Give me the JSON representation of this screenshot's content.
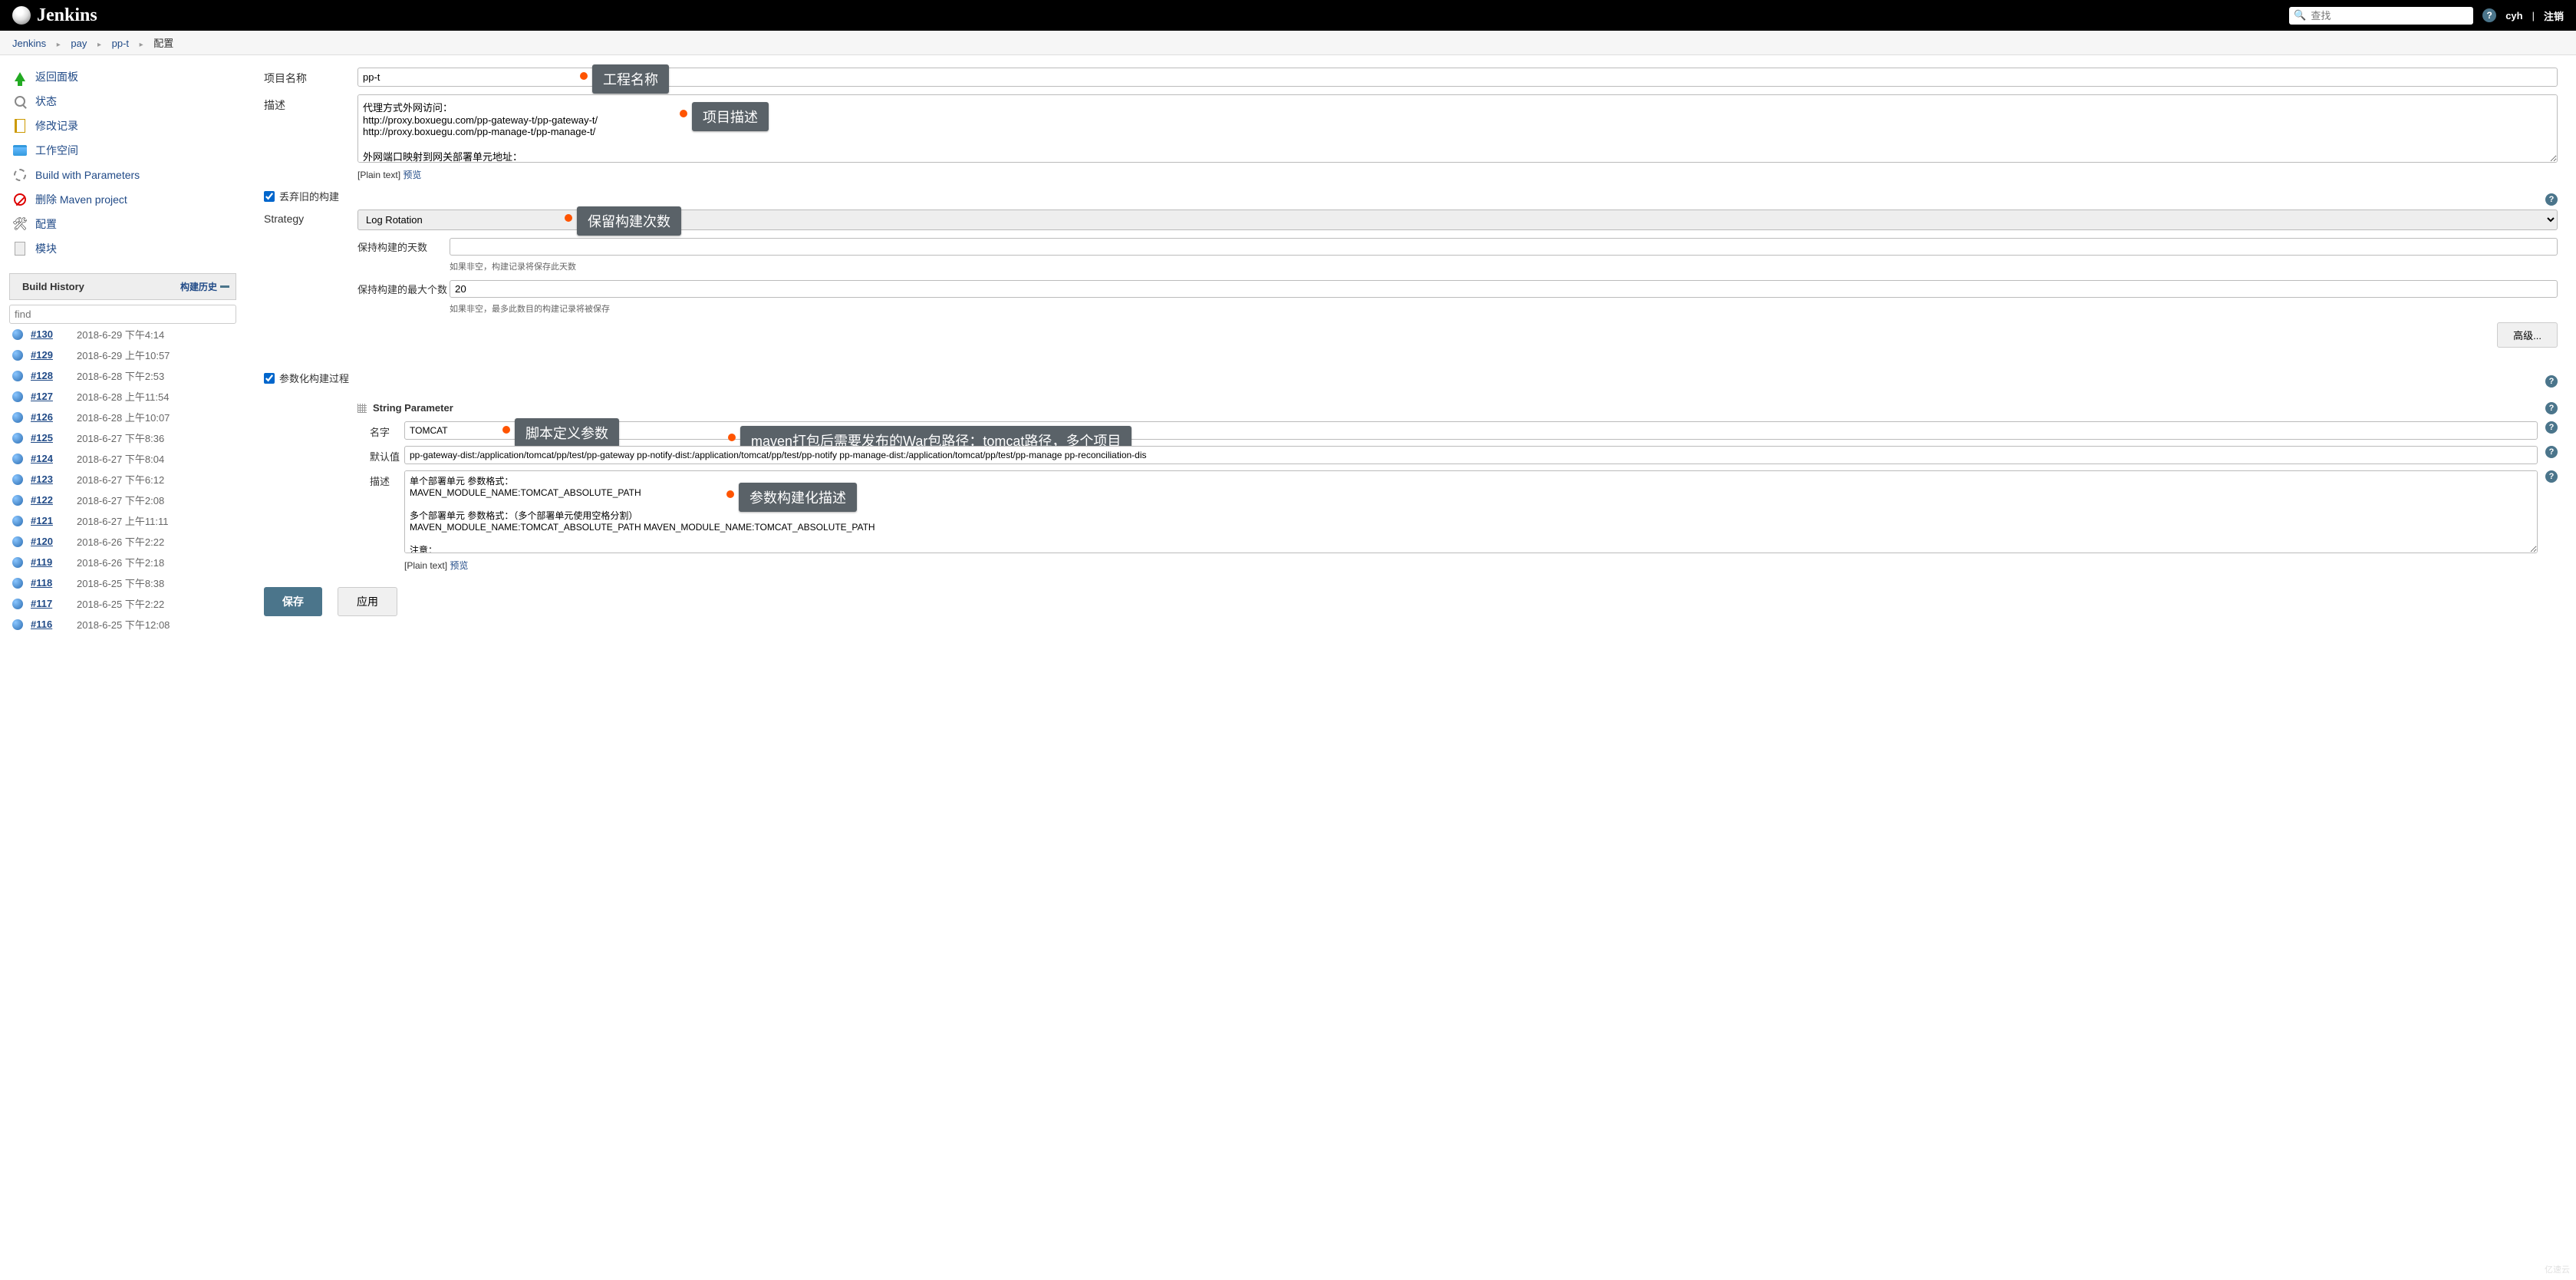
{
  "header": {
    "title": "Jenkins",
    "search_placeholder": "查找",
    "user": "cyh",
    "logout": "注销"
  },
  "breadcrumb": [
    "Jenkins",
    "pay",
    "pp-t",
    "配置"
  ],
  "sidebar": {
    "tasks": [
      {
        "label": "返回面板",
        "icon": "up-arrow-icon"
      },
      {
        "label": "状态",
        "icon": "magnify-icon"
      },
      {
        "label": "修改记录",
        "icon": "document-icon"
      },
      {
        "label": "工作空间",
        "icon": "folder-icon"
      },
      {
        "label": "Build with Parameters",
        "icon": "gear-play-icon"
      },
      {
        "label": "删除 Maven project",
        "icon": "no-entry-icon"
      },
      {
        "label": "配置",
        "icon": "tools-icon"
      },
      {
        "label": "模块",
        "icon": "module-icon"
      }
    ],
    "build_history": {
      "title": "Build History",
      "trend": "构建历史",
      "find_placeholder": "find",
      "builds": [
        {
          "num": "#130",
          "time": "2018-6-29 下午4:14"
        },
        {
          "num": "#129",
          "time": "2018-6-29 上午10:57"
        },
        {
          "num": "#128",
          "time": "2018-6-28 下午2:53"
        },
        {
          "num": "#127",
          "time": "2018-6-28 上午11:54"
        },
        {
          "num": "#126",
          "time": "2018-6-28 上午10:07"
        },
        {
          "num": "#125",
          "time": "2018-6-27 下午8:36"
        },
        {
          "num": "#124",
          "time": "2018-6-27 下午8:04"
        },
        {
          "num": "#123",
          "time": "2018-6-27 下午6:12"
        },
        {
          "num": "#122",
          "time": "2018-6-27 下午2:08"
        },
        {
          "num": "#121",
          "time": "2018-6-27 上午11:11"
        },
        {
          "num": "#120",
          "time": "2018-6-26 下午2:22"
        },
        {
          "num": "#119",
          "time": "2018-6-26 下午2:18"
        },
        {
          "num": "#118",
          "time": "2018-6-25 下午8:38"
        },
        {
          "num": "#117",
          "time": "2018-6-25 下午2:22"
        },
        {
          "num": "#116",
          "time": "2018-6-25 下午12:08"
        }
      ]
    }
  },
  "form": {
    "project_name_label": "项目名称",
    "project_name_value": "pp-t",
    "project_name_callout": "工程名称",
    "description_label": "描述",
    "description_value": "代理方式外网访问：\nhttp://proxy.boxuegu.com/pp-gateway-t/pp-gateway-t/\nhttp://proxy.boxuegu.com/pp-manage-t/pp-manage-t/\n\n外网端口映射到网关部署单元地址：",
    "description_callout": "项目描述",
    "plain_text": "[Plain text]",
    "preview": "预览",
    "discard_old_label": "丢弃旧的构建",
    "strategy_label": "Strategy",
    "strategy_value": "Log Rotation",
    "strategy_callout": "保留构建次数",
    "keep_days_label": "保持构建的天数",
    "keep_days_value": "",
    "keep_days_help": "如果非空，构建记录将保存此天数",
    "keep_max_label": "保持构建的最大个数",
    "keep_max_value": "20",
    "keep_max_help": "如果非空，最多此数目的构建记录将被保存",
    "advanced_btn": "高级...",
    "parameterized_label": "参数化构建过程",
    "string_param_title": "String Parameter",
    "param_name_label": "名字",
    "param_name_value": "TOMCAT",
    "param_name_callout": "脚本定义参数",
    "param_name_callout2": "maven打包后需要发布的War包路径：tomcat路径，多个项目",
    "param_default_label": "默认值",
    "param_default_value": "pp-gateway-dist:/application/tomcat/pp/test/pp-gateway pp-notify-dist:/application/tomcat/pp/test/pp-notify pp-manage-dist:/application/tomcat/pp/test/pp-manage pp-reconciliation-dis",
    "param_desc_label": "描述",
    "param_desc_value": "单个部署单元 参数格式：\nMAVEN_MODULE_NAME:TOMCAT_ABSOLUTE_PATH\n\n多个部署单元 参数格式：（多个部署单元使用空格分割）\nMAVEN_MODULE_NAME:TOMCAT_ABSOLUTE_PATH MAVEN_MODULE_NAME:TOMCAT_ABSOLUTE_PATH\n\n注意：\nMAVEN_MODULE_NAME：MAVEN模块名称",
    "param_desc_callout": "参数构建化描述",
    "save_btn": "保存",
    "apply_btn": "应用"
  },
  "watermark": "亿速云"
}
